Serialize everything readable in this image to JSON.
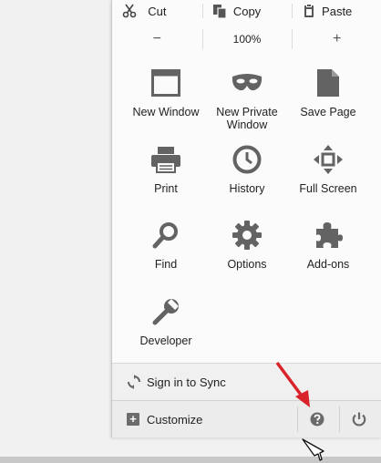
{
  "edit": {
    "cut": "Cut",
    "copy": "Copy",
    "paste": "Paste"
  },
  "zoom": {
    "out": "−",
    "level": "100%",
    "in": "+"
  },
  "items": {
    "new_window": "New Window",
    "new_private_window": "New Private Window",
    "save_page": "Save Page",
    "print": "Print",
    "history": "History",
    "full_screen": "Full Screen",
    "find": "Find",
    "options": "Options",
    "addons": "Add-ons",
    "developer": "Developer"
  },
  "sync": {
    "label": "Sign in to Sync"
  },
  "footer": {
    "customize": "Customize",
    "customize_plus": "+"
  },
  "colors": {
    "icon": "#636363",
    "arrow": "#d9232a",
    "panel": "#fbfbfb"
  },
  "icons": [
    "cut-icon",
    "copy-icon",
    "paste-icon",
    "window-icon",
    "mask-icon",
    "page-icon",
    "printer-icon",
    "clock-icon",
    "fullscreen-icon",
    "magnifier-icon",
    "gear-icon",
    "puzzle-icon",
    "wrench-icon",
    "sync-icon",
    "help-icon",
    "power-icon"
  ]
}
